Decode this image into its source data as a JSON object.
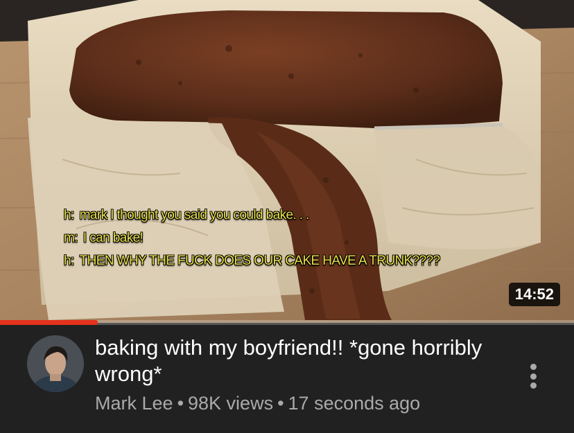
{
  "video": {
    "title": "baking with my boyfriend!! *gone horribly wrong*",
    "channel": "Mark Lee",
    "views": "98K views",
    "age": "17 seconds ago",
    "separator": "•",
    "duration": "14:52",
    "progress_fraction": 0.17
  },
  "captions": [
    {
      "speaker": "h:",
      "text": "mark I thought you said you could bake. . ."
    },
    {
      "speaker": "m:",
      "text": "I can bake!"
    },
    {
      "speaker": "h:",
      "text": "THEN WHY THE FUCK DOES OUR CAKE HAVE A TRUNK????"
    }
  ],
  "icons": {
    "more": "more-vert-icon"
  },
  "colors": {
    "progress": "#e5321d",
    "caption": "#e7e14a",
    "background": "#212121",
    "meta_text": "#aaaaaa"
  }
}
